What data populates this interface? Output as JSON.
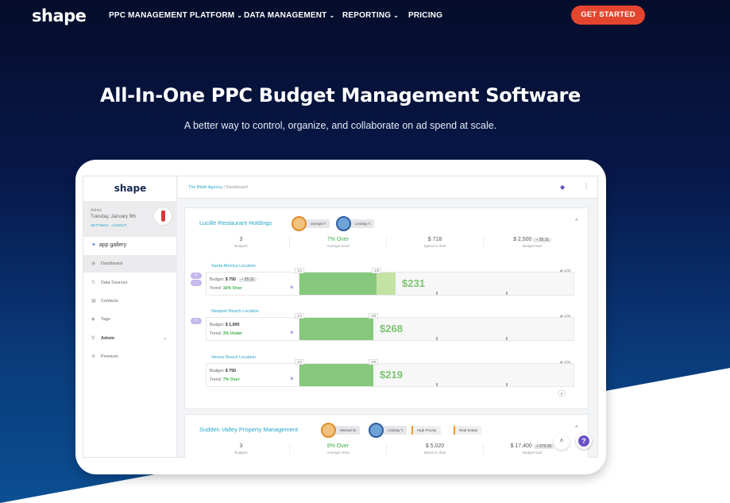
{
  "nav": {
    "logo": "shape",
    "items": [
      {
        "label": "PPC MANAGEMENT PLATFORM",
        "has_dropdown": true
      },
      {
        "label": "DATA MANAGEMENT",
        "has_dropdown": true
      },
      {
        "label": "REPORTING",
        "has_dropdown": true
      },
      {
        "label": "PRICING",
        "has_dropdown": false
      }
    ],
    "cta": "GET STARTED",
    "cta_color": "#e4452f"
  },
  "hero": {
    "title": "All-In-One PPC Budget Management Software",
    "subtitle": "A better way to control, organize, and collaborate on ad spend at scale."
  },
  "app": {
    "logo": "shape",
    "user": {
      "role": "Admin",
      "date": "Tuesday, January 9th",
      "links": "SETTINGS · LOGOUT"
    },
    "gallery_label": "app gallery",
    "sidebar_items": [
      {
        "label": "Dashboard",
        "icon": "dashboard-icon",
        "active": true
      },
      {
        "label": "Data Sources",
        "icon": "data-sources-icon",
        "active": false
      },
      {
        "label": "Contacts",
        "icon": "contacts-icon",
        "active": false
      },
      {
        "label": "Tags",
        "icon": "tag-icon",
        "active": false
      },
      {
        "label": "Admin",
        "icon": "key-icon",
        "active": false
      },
      {
        "label": "Premium",
        "icon": "premium-icon",
        "active": false
      }
    ],
    "breadcrumb": {
      "agency": "The Bluth Agency",
      "page": "Dashboard"
    },
    "cards": [
      {
        "title": "Lucille Restaurant Holdings",
        "people": [
          "George F.",
          "Lindsay T."
        ],
        "tags": [],
        "stats": [
          {
            "value": "3",
            "label": "Budgets"
          },
          {
            "value": "7% Over",
            "label": "Average trend"
          },
          {
            "value": "$ 718",
            "label": "Spend to date"
          },
          {
            "value": "$ 2,500",
            "badge": "− 25.11",
            "label": "Budget total"
          }
        ],
        "locations": [
          {
            "name": "Santa Monica Location",
            "budget": "$ 750",
            "budget_badge": "− 25.11",
            "trend": "16% Over",
            "amount": "$231",
            "tick_left": "1/1",
            "tick_mid": "1/9",
            "tick_right": "1/31",
            "fill": 0.28,
            "light": 0.35
          },
          {
            "name": "Newport Beach Location",
            "budget": "$ 1,000",
            "budget_badge": "",
            "trend": "3% Under",
            "amount": "$268",
            "tick_left": "1/1",
            "tick_mid": "1/9",
            "tick_right": "1/31",
            "fill": 0.27,
            "light": 0
          },
          {
            "name": "Venice Beach Location",
            "budget": "$ 750",
            "budget_badge": "",
            "trend": "7% Over",
            "amount": "$219",
            "tick_left": "1/1",
            "tick_mid": "1/9",
            "tick_right": "1/31",
            "fill": 0.27,
            "light": 0
          }
        ],
        "pager": "6"
      },
      {
        "title": "Sudden Valley Property Management",
        "people": [
          "Michael B.",
          "Lindsay T."
        ],
        "tags": [
          "High Priority",
          "Real Estate"
        ],
        "stats": [
          {
            "value": "3",
            "label": "Budgets"
          },
          {
            "value": "8% Over",
            "label": "Average trend"
          },
          {
            "value": "$ 5,020",
            "label": "Spend to date"
          },
          {
            "value": "$ 17,400",
            "badge": "+ 570.00",
            "label": "Budget total"
          }
        ]
      }
    ],
    "help_label": "?",
    "budget_prefix": "Budget:",
    "trend_prefix": "Trend:"
  }
}
